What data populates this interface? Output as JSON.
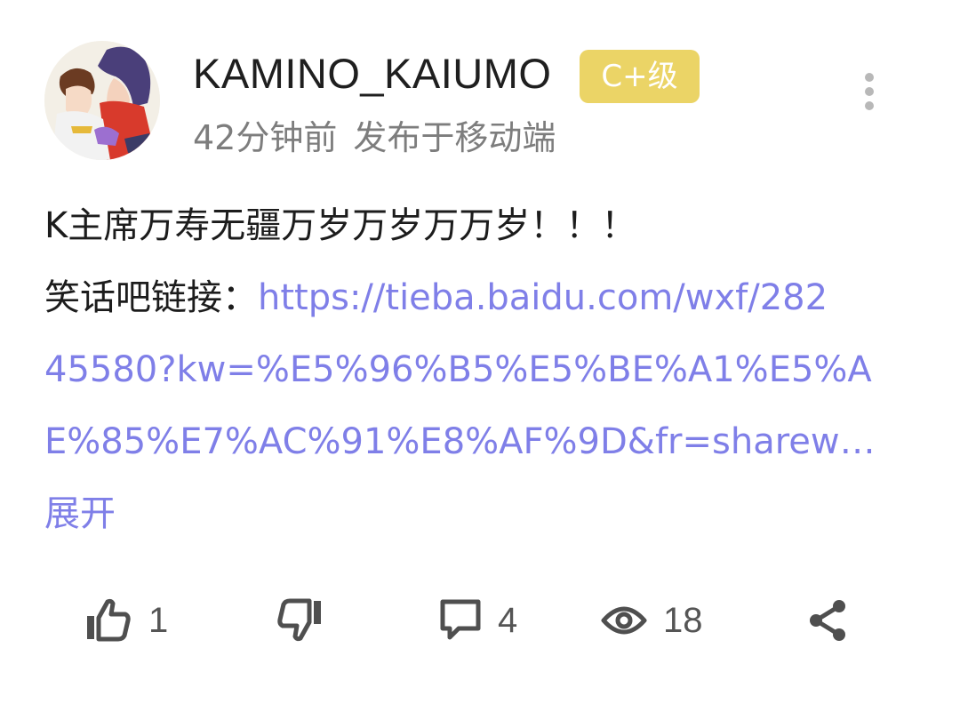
{
  "author": {
    "username": "KAMINO_KAIUMO",
    "level_badge": "C+级",
    "badge_color": "#ebd466"
  },
  "meta": {
    "time": "42分钟前",
    "source": "发布于移动端"
  },
  "post": {
    "line1": "K主席万寿无疆万岁万岁万万岁！！！",
    "link_prefix": "笑话吧链接：",
    "link_line1": "https://tieba.baidu.com/wxf/282",
    "link_line2": "45580?kw=%E5%96%B5%E5%BE%A1%E5%A",
    "link_line3": "E%85%E7%AC%91%E8%AF%9D&fr=sharew…",
    "expand_label": "展开",
    "link_color": "#7f7fe8"
  },
  "actions": {
    "like_count": "1",
    "comment_count": "4",
    "view_count": "18",
    "icons": [
      "thumbs-up-icon",
      "thumbs-down-icon",
      "comment-icon",
      "eye-icon",
      "share-icon"
    ]
  }
}
